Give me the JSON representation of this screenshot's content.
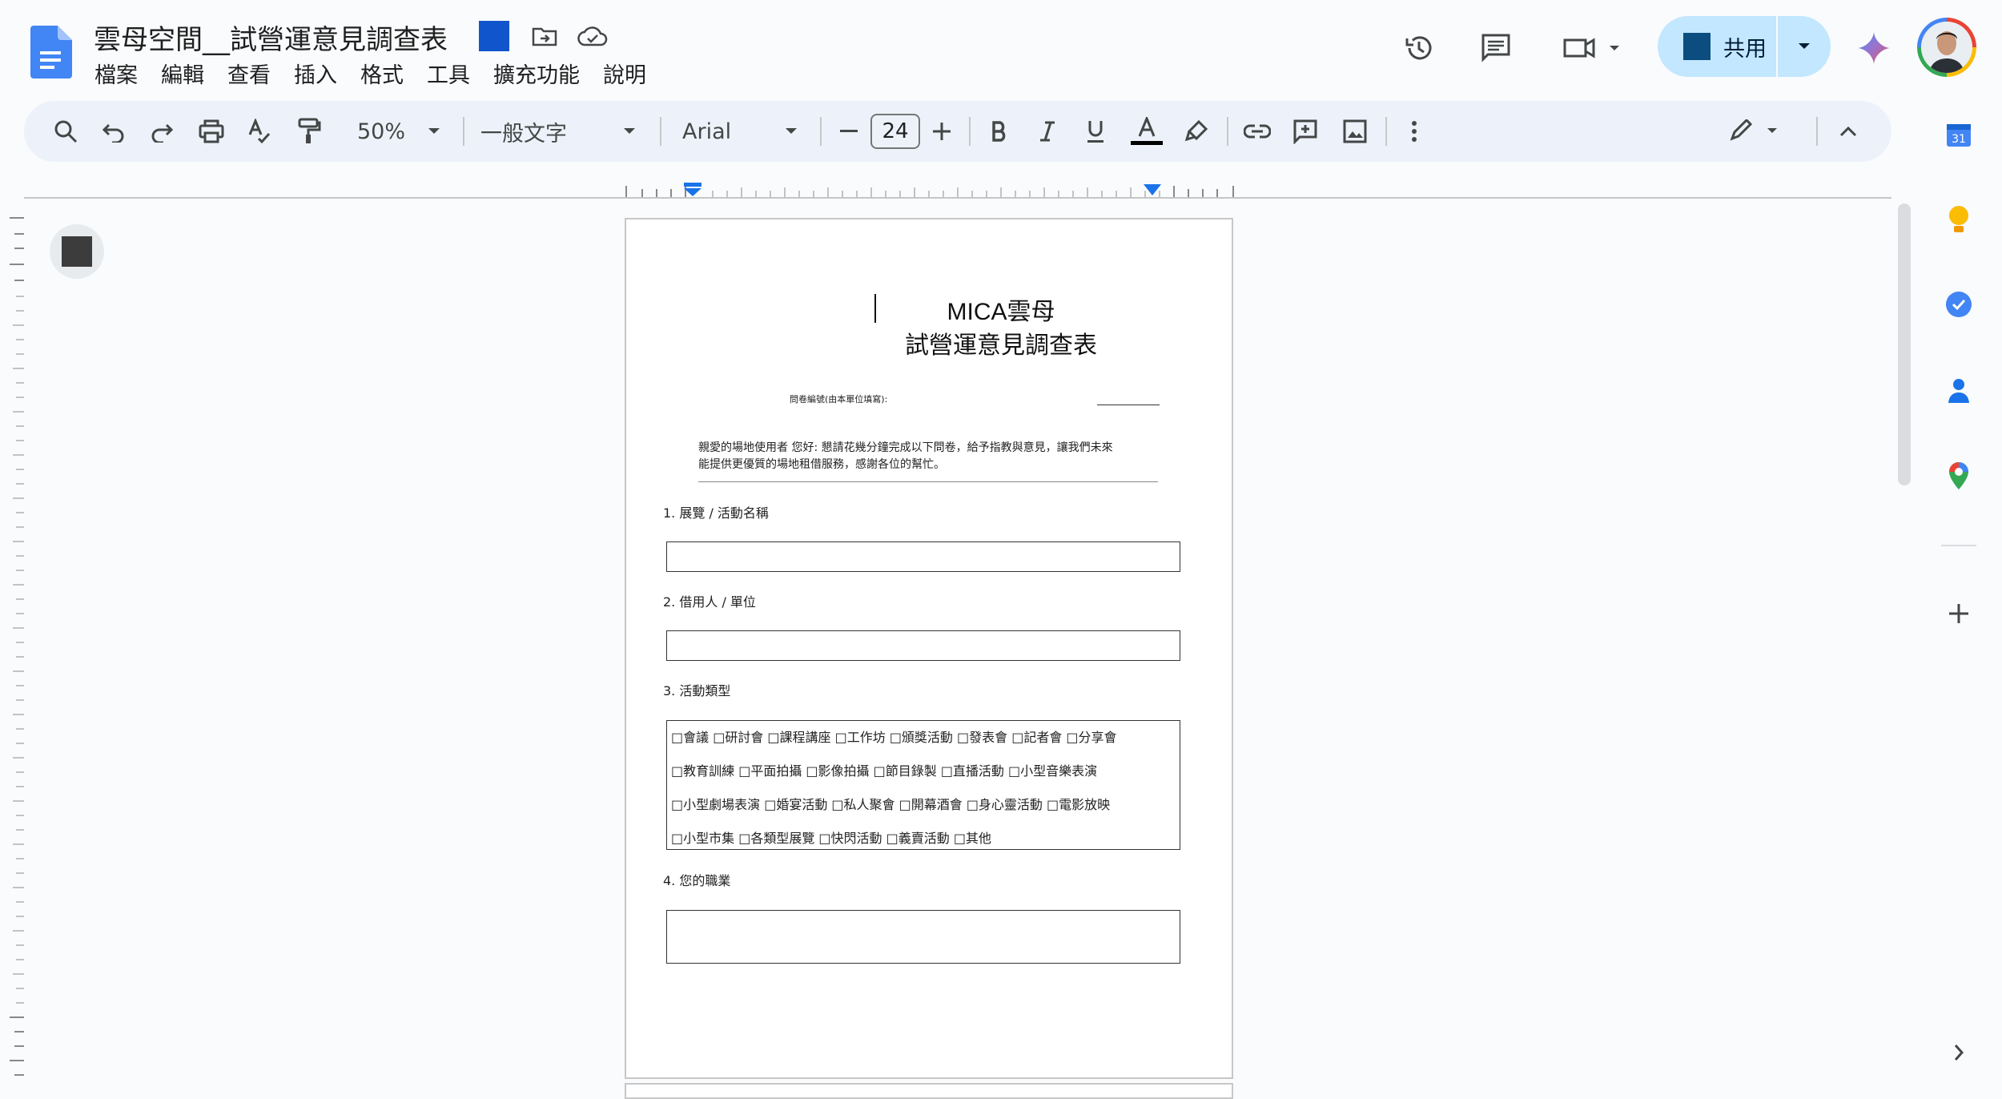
{
  "app": {
    "title": "雲母空間__試營運意見調查表",
    "menu": [
      "檔案",
      "編輯",
      "查看",
      "插入",
      "格式",
      "工具",
      "擴充功能",
      "說明"
    ],
    "share_label": "共用",
    "accent": "#1155cc"
  },
  "toolbar": {
    "zoom": "50%",
    "style": "一般文字",
    "font": "Arial",
    "font_size": "24"
  },
  "document": {
    "title_line1": "MICA雲母",
    "title_line2": "試營運意見調查表",
    "questionnaire_no": "問卷編號(由本單位填寫):",
    "intro_line1": "親愛的場地使用者 您好: 懇請花幾分鐘完成以下問卷，給予指教與意見，讓我們未來",
    "intro_line2": "能提供更優質的場地租借服務，感謝各位的幫忙。",
    "q1": "1. 展覽 / 活動名稱",
    "q2": "2. 借用人 / 單位",
    "q3": "3. 活動類型",
    "q3_options": [
      "□會議 □研討會 □課程講座 □工作坊 □頒獎活動 □發表會 □記者會 □分享會",
      "□教育訓練 □平面拍攝 □影像拍攝 □節目錄製 □直播活動 □小型音樂表演",
      "□小型劇場表演 □婚宴活動 □私人聚會 □開幕酒會 □身心靈活動 □電影放映",
      "□小型市集 □各類型展覽 □快閃活動 □義賣活動 □其他"
    ],
    "q4": "4. 您的職業"
  }
}
